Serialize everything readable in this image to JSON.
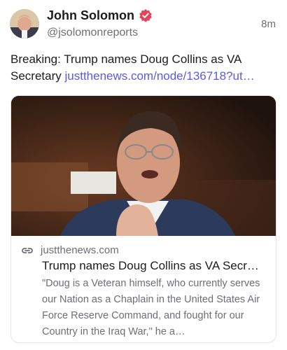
{
  "post": {
    "author_name": "John Solomon",
    "handle": "@jsolomonreports",
    "timestamp": "8m",
    "text": "Breaking: Trump names Doug Collins as VA Secretary ",
    "link_text": "justthenews.com/node/136718?ut…"
  },
  "card": {
    "domain": "justthenews.com",
    "title": "Trump names Doug Collins as VA Secr…",
    "description": "\"Doug is a Veteran himself, who currently serves our Nation as a Chaplain in the United States Air Force Reserve Command, and fought for our Country in the Iraq War,\" he a…"
  },
  "icons": {
    "verified": "verified-badge-icon",
    "link": "link-icon"
  },
  "colors": {
    "link": "#5a5ae6",
    "verified": "#e8425a",
    "muted": "#6e6e78"
  }
}
